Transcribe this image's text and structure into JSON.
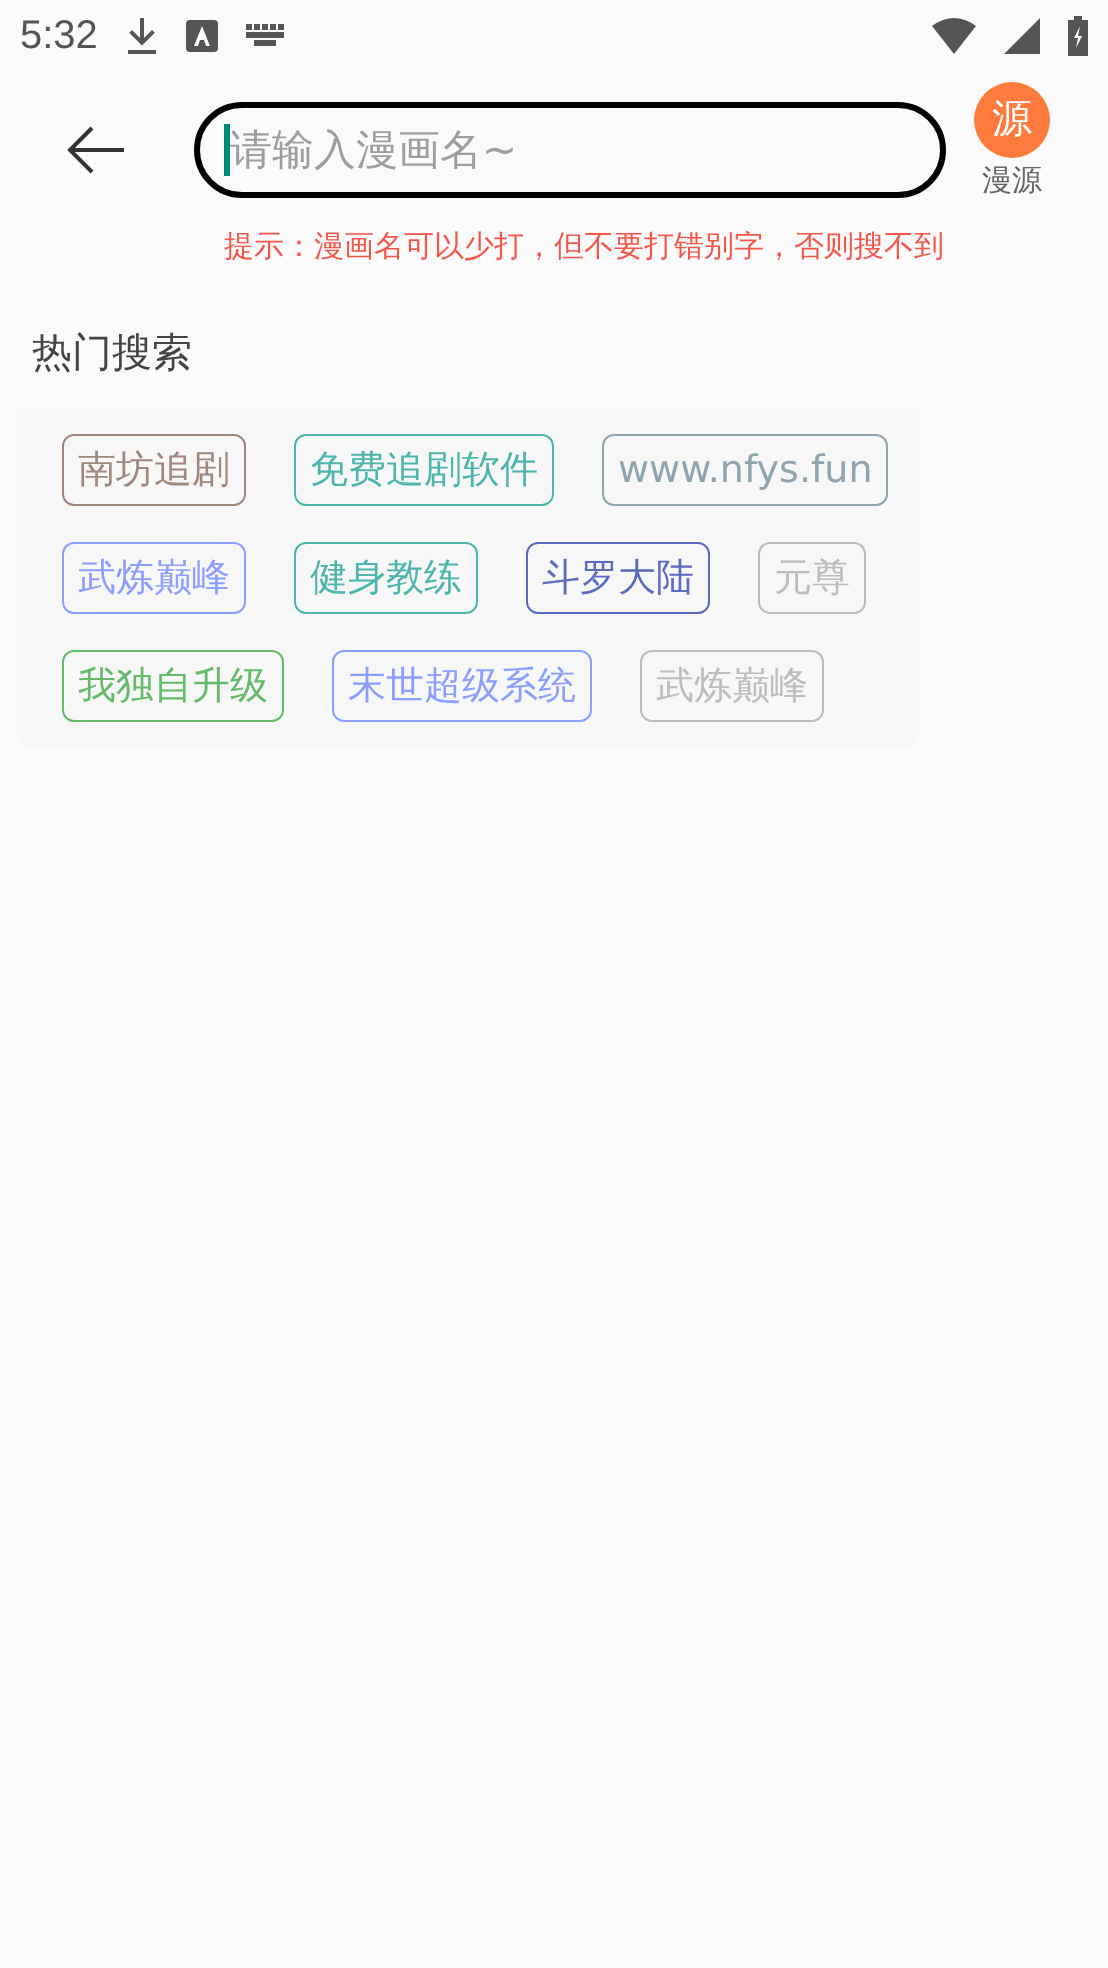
{
  "status_bar": {
    "time": "5:32"
  },
  "search": {
    "placeholder": "请输入漫画名~"
  },
  "source": {
    "badge": "源",
    "label": "漫源"
  },
  "hint": "提示：漫画名可以少打，但不要打错别字，否则搜不到",
  "hot": {
    "title": "热门搜索",
    "rows": [
      [
        {
          "label": "南坊追剧",
          "color": "#a1887f"
        },
        {
          "label": "免费追剧软件",
          "color": "#4db6ac"
        },
        {
          "label": "www.nfys.fun",
          "color": "#90a4ae"
        }
      ],
      [
        {
          "label": "武炼巅峰",
          "color": "#8c9eff"
        },
        {
          "label": "健身教练",
          "color": "#4db6ac"
        },
        {
          "label": "斗罗大陆",
          "color": "#5c6bc0"
        },
        {
          "label": "元尊",
          "color": "#bdbdbd"
        }
      ],
      [
        {
          "label": "我独自升级",
          "color": "#66bb6a"
        },
        {
          "label": "末世超级系统",
          "color": "#8c9eff"
        },
        {
          "label": "武炼巅峰",
          "color": "#bdbdbd"
        }
      ]
    ]
  }
}
